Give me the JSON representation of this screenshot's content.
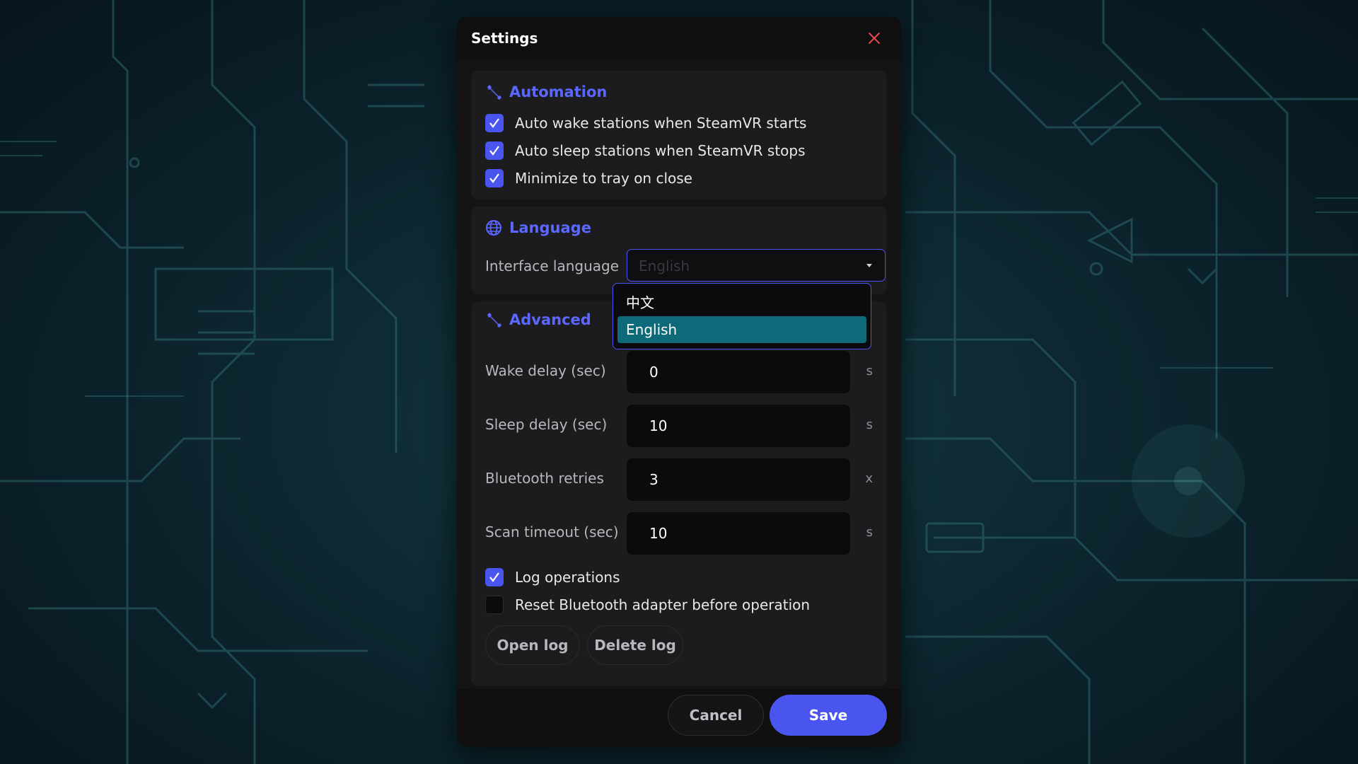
{
  "dialog": {
    "title": "Settings",
    "close_icon": "close-icon"
  },
  "automation": {
    "heading": "Automation",
    "icon": "wrench-icon",
    "options": [
      {
        "label": "Auto wake stations when SteamVR starts",
        "checked": true
      },
      {
        "label": "Auto sleep stations when SteamVR stops",
        "checked": true
      },
      {
        "label": "Minimize to tray on close",
        "checked": true
      }
    ]
  },
  "language": {
    "heading": "Language",
    "icon": "globe-icon",
    "field_label": "Interface language",
    "selected": "English",
    "options": [
      {
        "label": "中文",
        "selected": false
      },
      {
        "label": "English",
        "selected": true
      }
    ]
  },
  "advanced": {
    "heading": "Advanced",
    "icon": "wrench-icon",
    "fields": [
      {
        "label": "Wake delay (sec)",
        "value": "0",
        "unit": "s"
      },
      {
        "label": "Sleep delay (sec)",
        "value": "10",
        "unit": "s"
      },
      {
        "label": "Bluetooth retries",
        "value": "3",
        "unit": "x"
      },
      {
        "label": "Scan timeout (sec)",
        "value": "10",
        "unit": "s"
      }
    ],
    "options": [
      {
        "label": "Log operations",
        "checked": true
      },
      {
        "label": "Reset Bluetooth adapter before operation",
        "checked": false
      }
    ],
    "open_log_label": "Open log",
    "delete_log_label": "Delete log"
  },
  "footer": {
    "cancel_label": "Cancel",
    "save_label": "Save"
  },
  "colors": {
    "accent": "#4a55f0",
    "heading": "#5b67ff",
    "selected_option": "#0e6a78",
    "close": "#e5484d"
  }
}
